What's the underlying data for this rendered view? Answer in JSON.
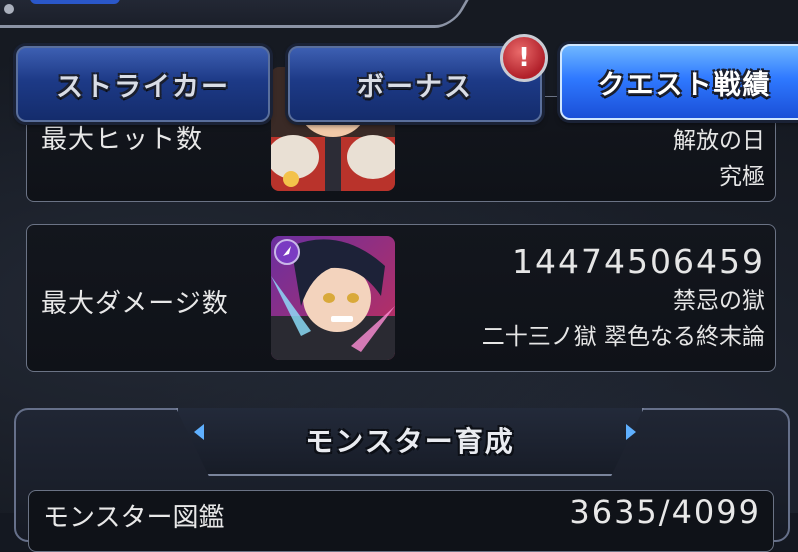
{
  "tabs": [
    {
      "label": "ストライカー",
      "active": false
    },
    {
      "label": "ボーナス",
      "active": false,
      "alert": "!"
    },
    {
      "label": "クエスト戦績",
      "active": true
    }
  ],
  "records": [
    {
      "label": "最大ヒット数",
      "lines": [
        "解放の日",
        "究極"
      ]
    },
    {
      "label": "最大ダメージ数",
      "value": "14474506459",
      "lines": [
        "禁忌の獄",
        "二十三ノ獄 翠色なる終末論"
      ]
    }
  ],
  "section": {
    "title": "モンスター育成",
    "row": {
      "label": "モンスター図鑑",
      "value": "3635/4099"
    }
  },
  "colors": {
    "tab_active": "#2f79ff",
    "tab_inactive": "#1d3a87",
    "alert": "#b1202a",
    "panel_border": "#6b7385"
  }
}
